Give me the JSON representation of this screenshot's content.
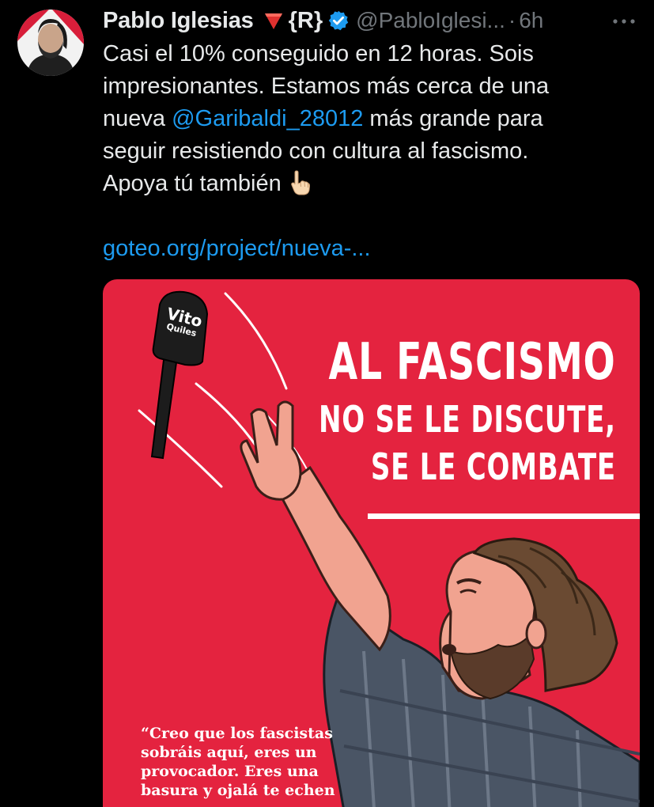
{
  "tweet": {
    "display_name": "Pablo Iglesias",
    "r_tag": "{R}",
    "handle": "@PabloIglesi...",
    "separator": "·",
    "time": "6h",
    "text_lines": [
      "Casi el 10% conseguido en 12 horas. Sois",
      "impresionantes. Estamos más cerca de una"
    ],
    "line3_before": "nueva ",
    "mention": "@Garibaldi_28012",
    "line3_after": " más grande para",
    "line4": "seguir resistiendo con cultura al fascismo.",
    "line5": "Apoya tú también",
    "link": "goteo.org/project/nueva-...",
    "icons": {
      "flag": "red-triangle-down-icon",
      "verified": "verified-badge-icon",
      "more": "more-options-icon",
      "pointing": "backhand-index-pointing-down-icon"
    }
  },
  "poster": {
    "headline1": "AL FASCISMO",
    "headline2": "NO SE LE DISCUTE,",
    "headline3": "SE LE COMBATE",
    "mic_brand": "Vito",
    "mic_sub": "Quiles",
    "quote_lines": [
      "“Creo que los fascistas",
      "sobráis aquí, eres un",
      "provocador. Eres una",
      "basura y ojalá te echen"
    ]
  },
  "colors": {
    "background": "#000000",
    "text": "#e7e9ea",
    "muted": "#71767b",
    "link": "#1d9bf0",
    "poster_red": "#e4233f",
    "verified": "#1d9bf0"
  }
}
